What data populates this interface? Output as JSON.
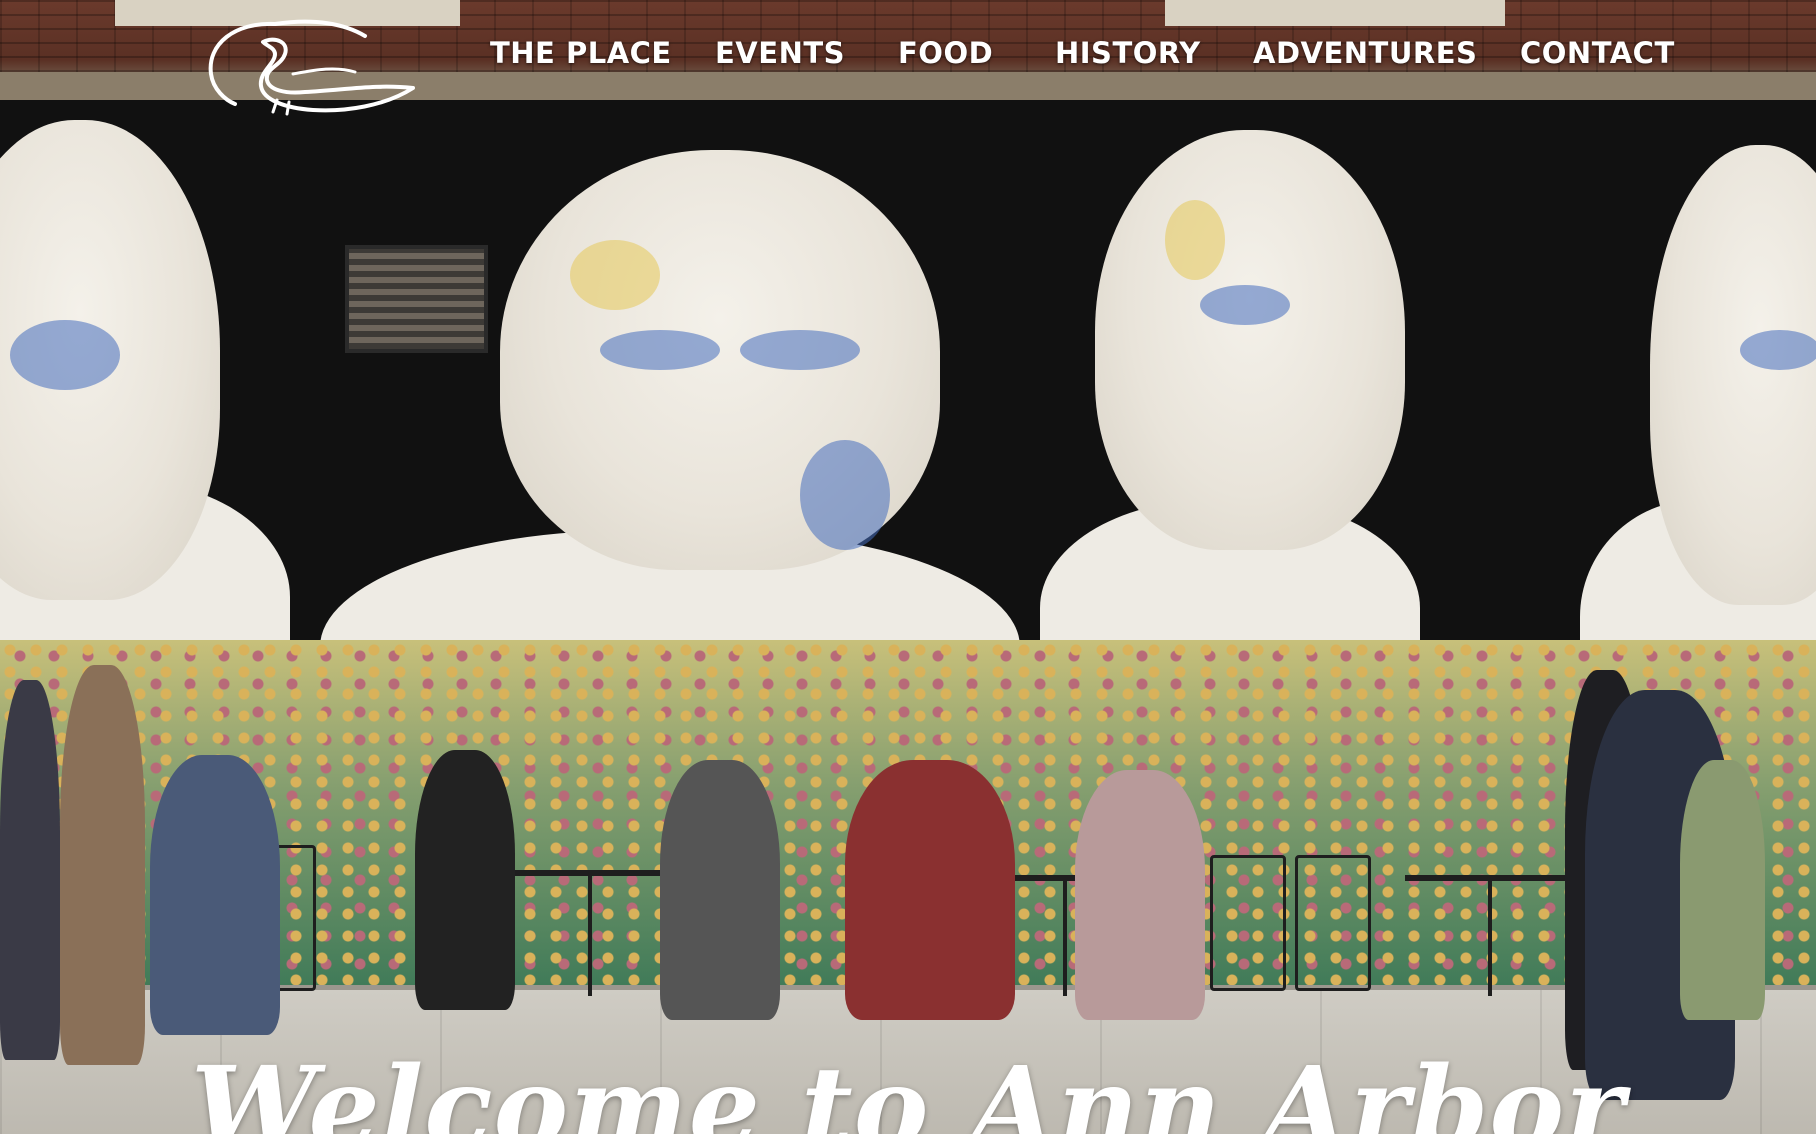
{
  "nav": {
    "items": [
      {
        "label": "THE PLACE"
      },
      {
        "label": "EVENTS"
      },
      {
        "label": "FOOD"
      },
      {
        "label": "HISTORY"
      },
      {
        "label": "ADVENTURES"
      },
      {
        "label": "CONTACT"
      }
    ]
  },
  "logo": {
    "icon": "swan-logo-icon"
  },
  "hero": {
    "headline": "Welcome to Ann Arbor",
    "background": "street-mural-photo"
  },
  "colors": {
    "nav_text": "#ffffff",
    "headline": "#ffffff",
    "mural_background": "#111111"
  }
}
